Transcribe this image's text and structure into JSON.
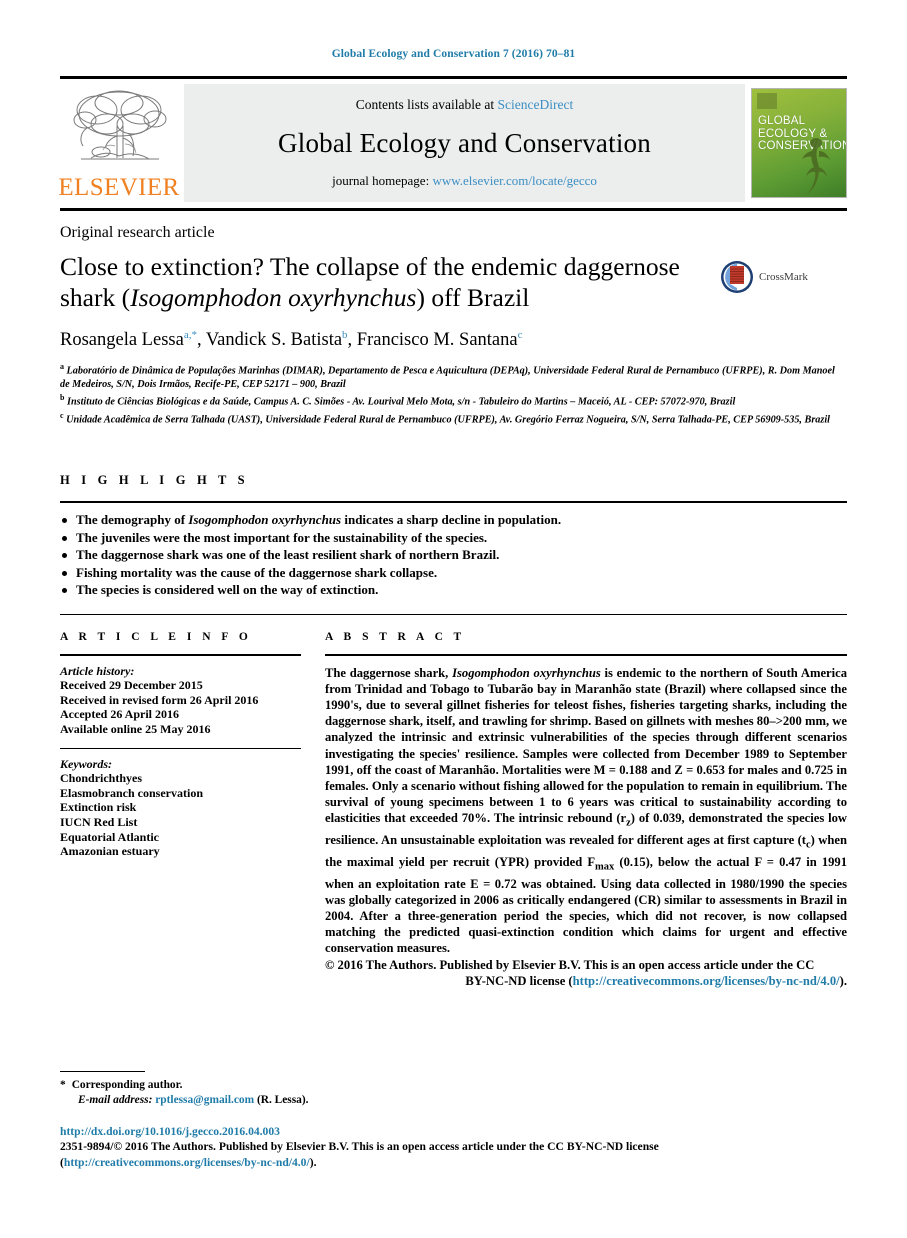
{
  "running_head": "Global Ecology and Conservation 7 (2016) 70–81",
  "masthead": {
    "publisher_logo_label": "ELSEVIER",
    "contents_prefix": "Contents lists available at ",
    "contents_link": "ScienceDirect",
    "journal_name": "Global Ecology and Conservation",
    "homepage_prefix": "journal homepage: ",
    "homepage_url": "www.elsevier.com/locate/gecco",
    "cover_title_line1": "GLOBAL",
    "cover_title_line2": "ECOLOGY &",
    "cover_title_line3": "CONSERVATION"
  },
  "article": {
    "type": "Original research article",
    "title_part1": "Close to extinction? The collapse of the endemic daggernose shark (",
    "title_italic": "Isogomphodon oxyrhynchus",
    "title_part2": ") off Brazil",
    "crossmark_label": "CrossMark",
    "authors": [
      {
        "name": "Rosangela Lessa",
        "sup": "a,*"
      },
      {
        "name": "Vandick S. Batista",
        "sup": "b"
      },
      {
        "name": "Francisco M. Santana",
        "sup": "c"
      }
    ],
    "affiliations": [
      {
        "marker": "a",
        "text": "Laboratório de Dinâmica de Populações Marinhas (DIMAR), Departamento de Pesca e Aquicultura (DEPAq), Universidade Federal Rural de Pernambuco (UFRPE), R. Dom Manoel de Medeiros, S/N, Dois Irmãos, Recife-PE, CEP 52171 – 900, Brazil"
      },
      {
        "marker": "b",
        "text": "Instituto de Ciências Biológicas e da Saúde, Campus A. C. Simões - Av. Lourival Melo Mota, s/n - Tabuleiro do Martins – Maceió, AL - CEP: 57072-970, Brazil"
      },
      {
        "marker": "c",
        "text": "Unidade Acadêmica de Serra Talhada (UAST), Universidade Federal Rural de Pernambuco (UFRPE), Av. Gregório Ferraz Nogueira, S/N, Serra Talhada-PE, CEP 56909-535, Brazil"
      }
    ]
  },
  "highlights": {
    "heading": "H I G H L I G H T S",
    "items": [
      {
        "pre": "The demography of ",
        "italic": "Isogomphodon oxyrhynchus",
        "post": " indicates a sharp decline in population."
      },
      {
        "pre": "The juveniles were the most important for the sustainability of the species.",
        "italic": "",
        "post": ""
      },
      {
        "pre": "The daggernose shark was one of the least resilient shark of northern Brazil.",
        "italic": "",
        "post": ""
      },
      {
        "pre": "Fishing mortality was the cause of the daggernose shark collapse.",
        "italic": "",
        "post": ""
      },
      {
        "pre": "The species is considered well on the way of extinction.",
        "italic": "",
        "post": ""
      }
    ]
  },
  "article_info": {
    "heading": "A R T I C L E    I N F O",
    "history_label": "Article history:",
    "history": [
      "Received 29 December 2015",
      "Received in revised form 26 April 2016",
      "Accepted 26 April 2016",
      "Available online 25 May 2016"
    ],
    "keywords_label": "Keywords:",
    "keywords": [
      "Chondrichthyes",
      "Elasmobranch conservation",
      "Extinction risk",
      "IUCN Red List",
      "Equatorial Atlantic",
      "Amazonian estuary"
    ]
  },
  "abstract": {
    "heading": "A B S T R A C T",
    "p1_a": "The daggernose shark, ",
    "p1_italic": "Isogomphodon oxyrhynchus",
    "p1_b": " is endemic to the northern of South America from Trinidad and Tobago to Tubarão bay in Maranhão state (Brazil) where collapsed since the 1990's, due to several gillnet fisheries for teleost fishes, fisheries targeting sharks, including the daggernose shark, itself, and trawling for shrimp. Based on gillnets with meshes 80–>200 mm, we analyzed the intrinsic and extrinsic vulnerabilities of the species through different scenarios investigating the species' resilience. Samples were collected from December 1989 to September 1991, off the coast of Maranhão. Mortalities were M = 0.188 and Z = 0.653 for males and 0.725 in females. Only a scenario without fishing allowed for the population to remain in equilibrium. The survival of young specimens between 1 to 6 years was critical to sustainability according to elasticities that exceeded 70%. The intrinsic rebound (r",
    "p1_sub": "z",
    "p1_c": ") of 0.039, demonstrated the species low resilience. An unsustainable exploitation was revealed for different ages at first capture (t",
    "p1_sub2": "c",
    "p1_d": ") when the maximal yield per recruit (YPR) provided F",
    "p1_sub3": "max",
    "p1_e": " (0.15), below the actual F = 0.47 in 1991 when an exploitation rate E = 0.72 was obtained. Using data collected in 1980/1990 the species was globally categorized in 2006 as critically endangered (CR) similar to assessments in Brazil in 2004. After a three-generation period the species, which did not recover, is now collapsed matching the predicted quasi-extinction condition which claims for urgent and effective conservation measures.",
    "copyright": "© 2016 The Authors. Published by Elsevier B.V. This is an open access article under the CC",
    "license_prefix": "BY-NC-ND license (",
    "license_url": "http://creativecommons.org/licenses/by-nc-nd/4.0/",
    "license_suffix": ")."
  },
  "footer": {
    "corresponding_star": "*",
    "corresponding_text": "Corresponding author.",
    "email_label": "E-mail address:",
    "email": "rptlessa@gmail.com",
    "email_owner": "(R. Lessa).",
    "doi_url": "http://dx.doi.org/10.1016/j.gecco.2016.04.003",
    "issn_line_a": "2351-9894/© 2016 The Authors. Published by Elsevier B.V. This is an open access article under the CC BY-NC-ND license (",
    "issn_link_a": "http://creativecommons.org/",
    "issn_link_b": "licenses/by-nc-nd/4.0/",
    "issn_line_b": ")."
  },
  "colors": {
    "link": "#1f7ba8",
    "link_light": "#3c8fc4",
    "elsevier_orange": "#f08122",
    "masthead_bg": "#eceded"
  }
}
